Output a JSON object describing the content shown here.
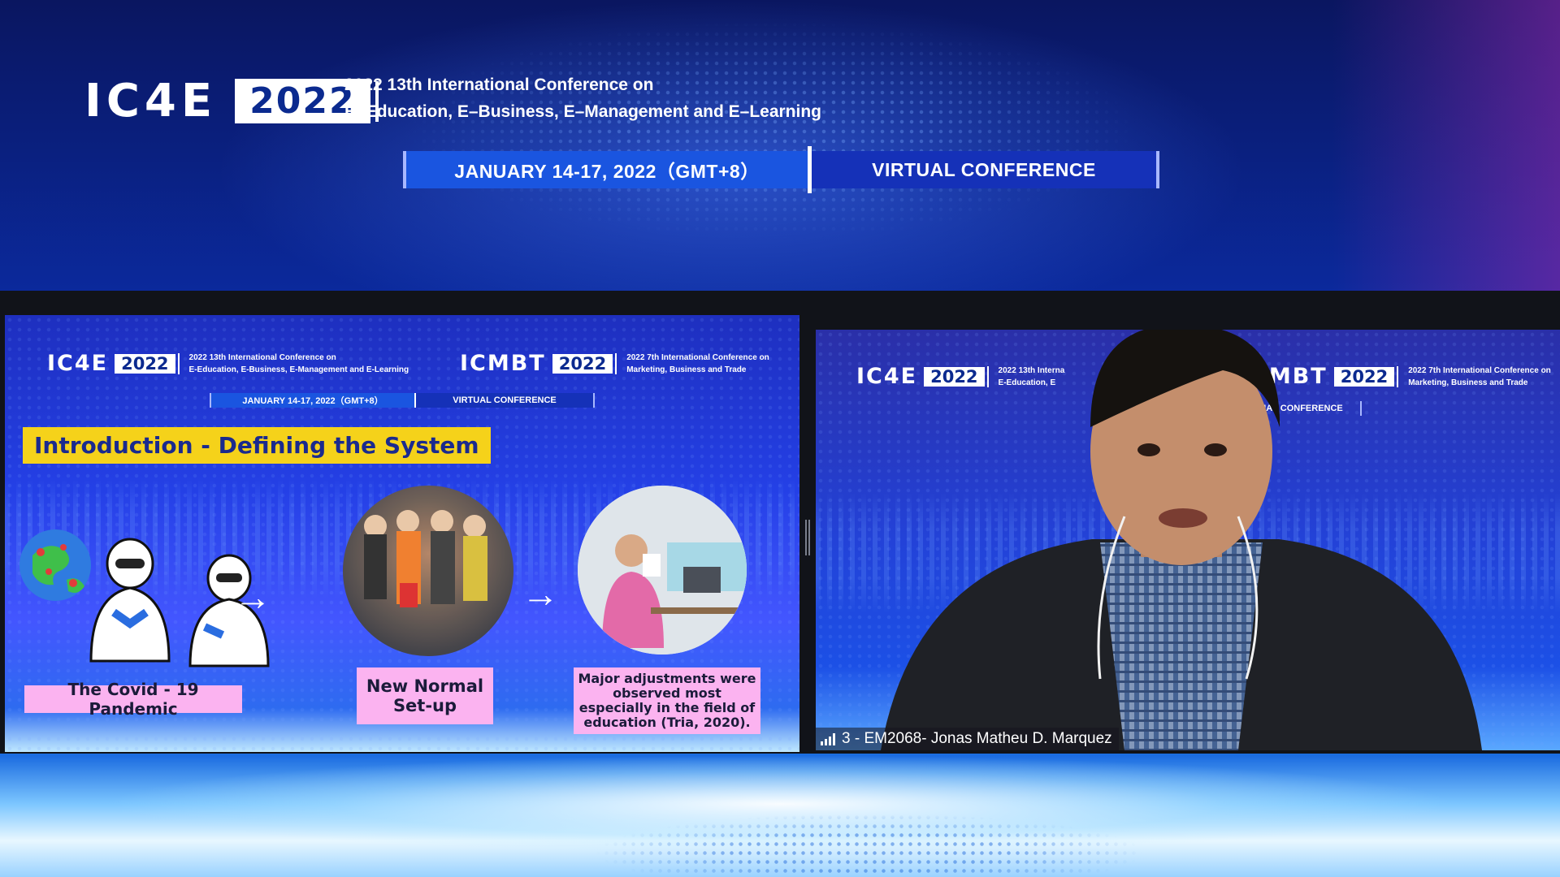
{
  "header": {
    "logo_text": "IC4E",
    "logo_year": "2022",
    "conference_line1": "2022 13th International Conference on",
    "conference_line2": "E–Education, E–Business, E–Management and E–Learning",
    "dates": "JANUARY 14-17, 2022（GMT+8）",
    "venue": "VIRTUAL CONFERENCE"
  },
  "slide": {
    "logo1_text": "IC4E",
    "logo1_year": "2022",
    "conf1_line1": "2022 13th International Conference on",
    "conf1_line2": "E-Education, E-Business, E-Management and E-Learning",
    "logo2_text": "ICMBT",
    "logo2_year": "2022",
    "conf2_line1": "2022 7th International Conference on",
    "conf2_line2": "Marketing, Business and Trade",
    "dates": "JANUARY 14-17, 2022（GMT+8）",
    "venue": "VIRTUAL CONFERENCE",
    "title": "Introduction - Defining the System",
    "caption1": "The Covid - 19 Pandemic",
    "caption2": "New Normal Set-up",
    "caption3": "Major adjustments were observed most especially in the field of education (Tria, 2020)."
  },
  "video": {
    "logo1_text": "IC4E",
    "logo1_year": "2022",
    "conf1_line1": "2022 13th Interna",
    "conf1_line2": "E-Education, E",
    "logo2_text": "ICMBT",
    "logo2_year": "2022",
    "conf2_line1": "2022 7th International Conference on",
    "conf2_line2": "Marketing, Business and Trade",
    "venue": "VIRTUAL CONFERENCE",
    "participant_name": "3 - EM2068- Jonas Matheu D. Marquez"
  },
  "colors": {
    "accent_blue": "#1a55e0",
    "title_yellow": "#f5d21a",
    "caption_pink": "#fbb3f0"
  }
}
